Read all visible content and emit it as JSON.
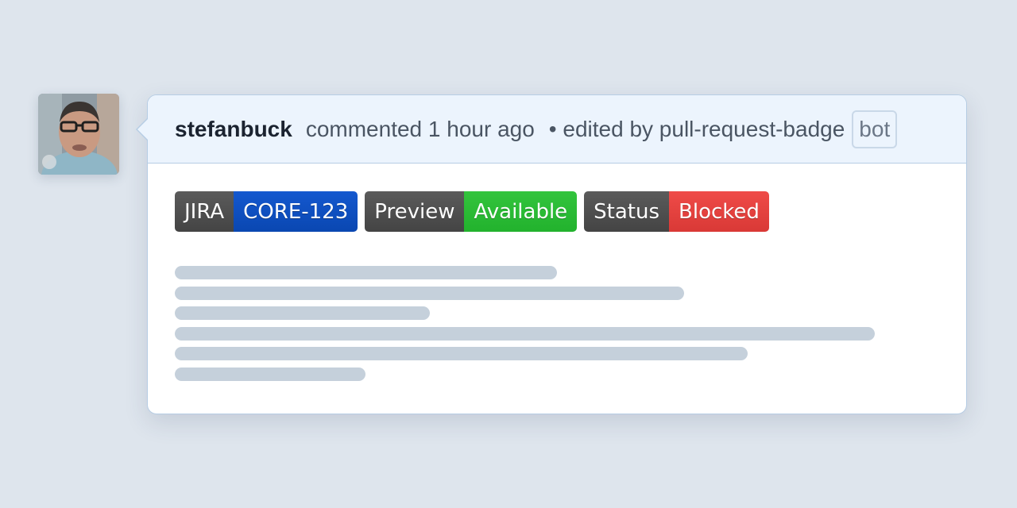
{
  "comment": {
    "author": "stefanbuck",
    "commented_text": "commented 1 hour ago",
    "edited_text": "• edited by pull-request-badge",
    "bot_label": "bot"
  },
  "badges": [
    {
      "key": "JIRA",
      "value": "CORE-123",
      "color": "#0a4fc4"
    },
    {
      "key": "Preview",
      "value": "Available",
      "color": "#27b833"
    },
    {
      "key": "Status",
      "value": "Blocked",
      "color": "#e0403d"
    }
  ],
  "placeholder_line_count": 6,
  "colors": {
    "background": "#dee5ed",
    "header_background": "#ecf4fd",
    "border": "#b6cde4",
    "placeholder": "#c5d0db"
  }
}
